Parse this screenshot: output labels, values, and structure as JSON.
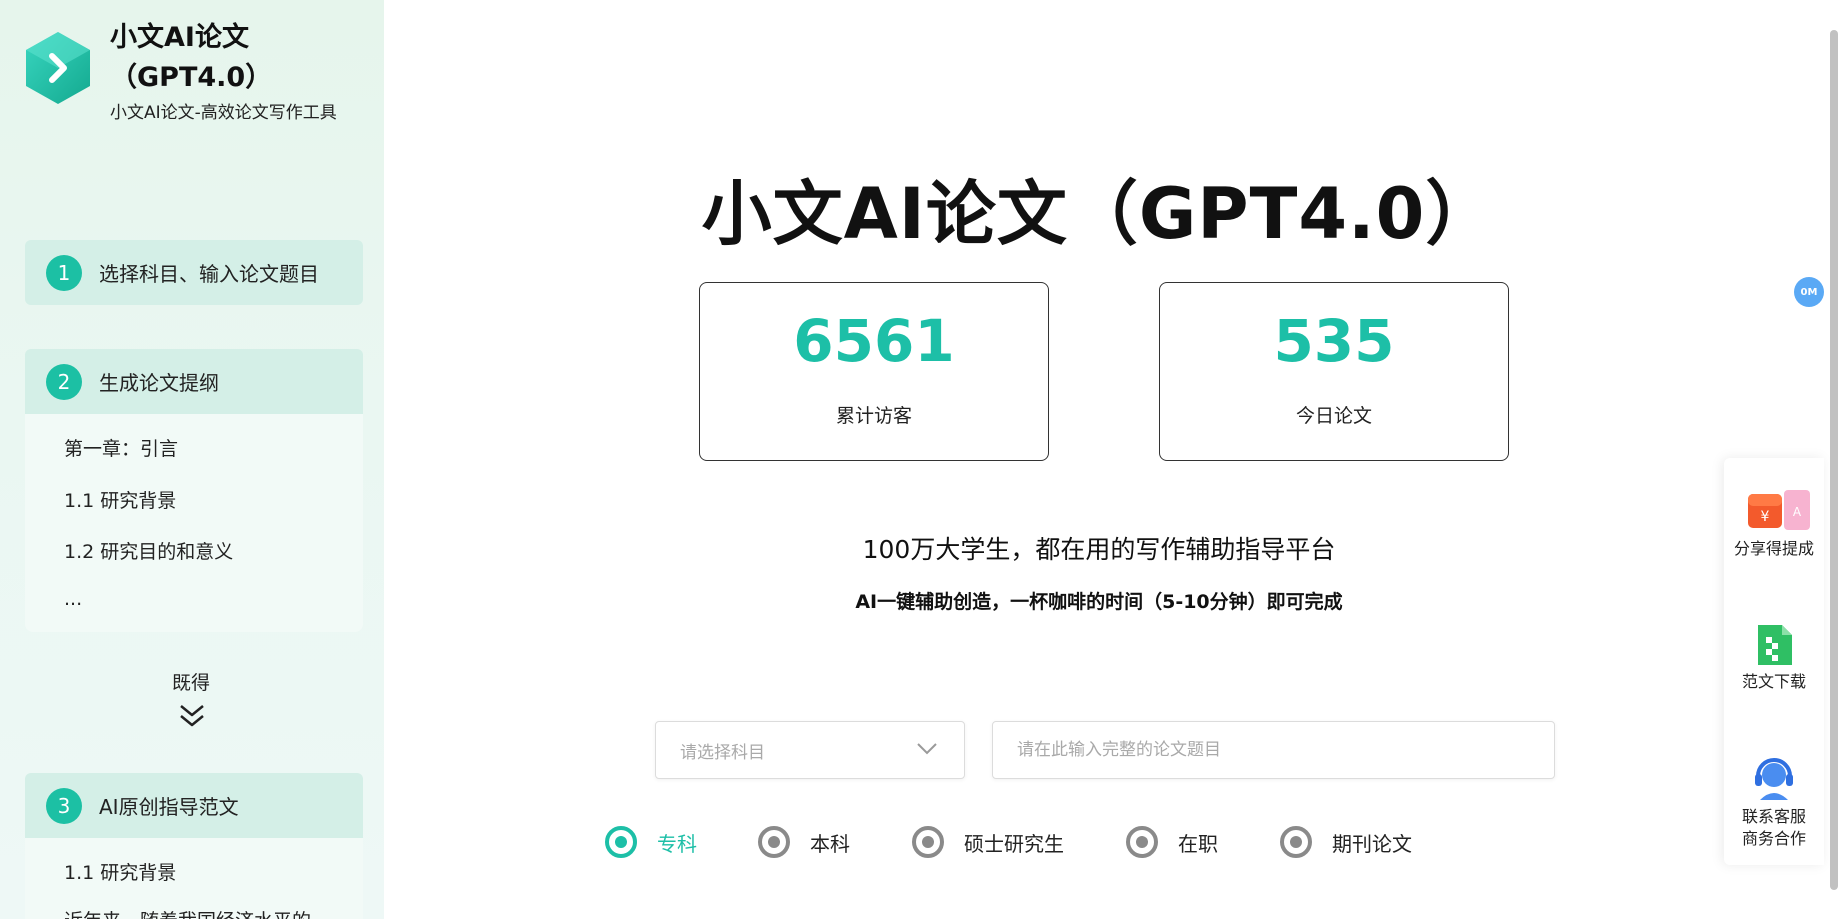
{
  "brand": {
    "title_line1": "小文AI论文",
    "title_line2": "（GPT4.0）",
    "subtitle": "小文AI论文-高效论文写作工具"
  },
  "steps": [
    {
      "number": "1",
      "label": "选择科目、输入论文题目"
    },
    {
      "number": "2",
      "label": "生成论文提纲",
      "items": [
        "第一章：引言",
        "1.1 研究背景",
        "1.2 研究目的和意义",
        "..."
      ]
    },
    {
      "number": "3",
      "label": "AI原创指导范文",
      "items": [
        "1.1 研究背景",
        "近年来，随着我国经济水平的"
      ]
    }
  ],
  "expand": {
    "label": "既得",
    "icon": "double-chevron-down-icon"
  },
  "main": {
    "title": "小文AI论文（GPT4.0）",
    "stats": [
      {
        "value": "6561",
        "label": "累计访客"
      },
      {
        "value": "535",
        "label": "今日论文"
      }
    ],
    "slogan": "100万大学生，都在用的写作辅助指导平台",
    "slogan_sub": "AI一键辅助创造，一杯咖啡的时间（5-10分钟）即可完成",
    "subject_placeholder": "请选择科目",
    "title_placeholder": "请在此输入完整的论文题目",
    "levels": [
      {
        "label": "专科",
        "selected": true
      },
      {
        "label": "本科",
        "selected": false
      },
      {
        "label": "硕士研究生",
        "selected": false
      },
      {
        "label": "在职",
        "selected": false
      },
      {
        "label": "期刊论文",
        "selected": false
      }
    ]
  },
  "float": {
    "badge": "0M",
    "share_label": "分享得提成",
    "download_label": "范文下载",
    "contact_line1": "联系客服",
    "contact_line2": "商务合作"
  },
  "colors": {
    "accent": "#1dbfa7",
    "sidebar_bg": "#e8f6ef",
    "step_head": "#d4efe7"
  }
}
